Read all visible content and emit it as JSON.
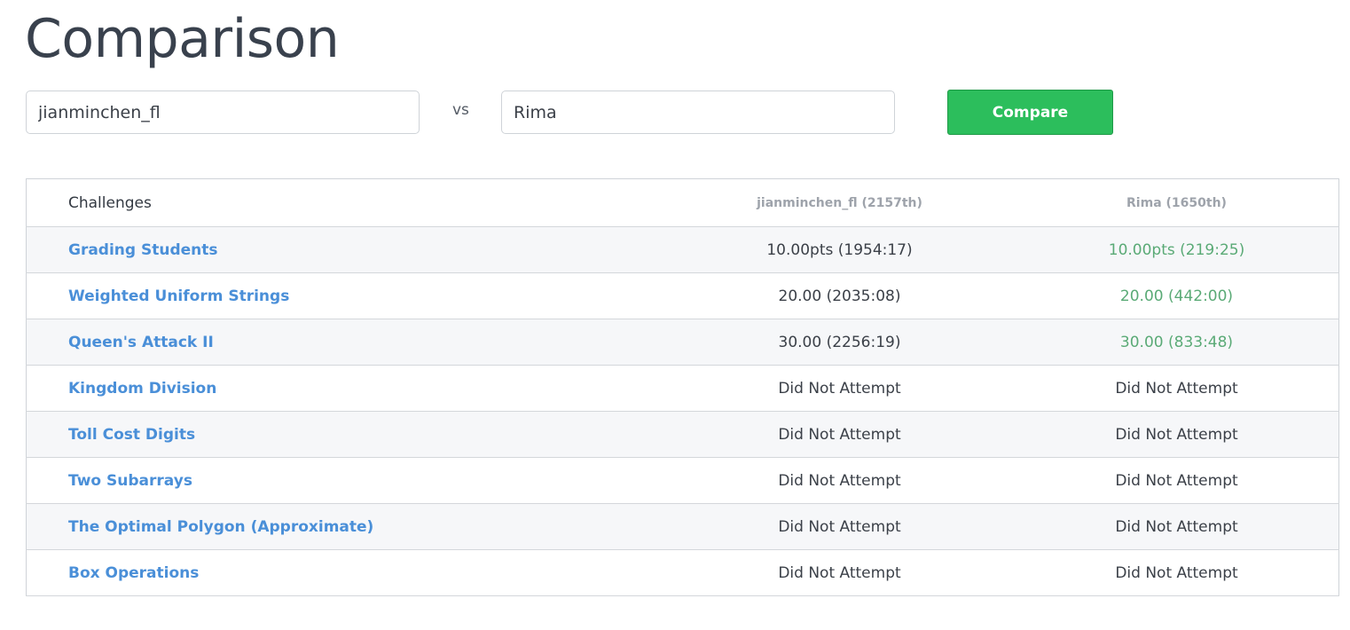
{
  "page": {
    "title": "Comparison"
  },
  "form": {
    "user_a_value": "jianminchen_fl",
    "vs_label": "vs",
    "user_b_value": "Rima",
    "compare_label": "Compare"
  },
  "table": {
    "header_challenges": "Challenges",
    "header_user_a": "jianminchen_fl (2157th)",
    "header_user_b": "Rima (1650th)",
    "rows": [
      {
        "challenge": "Grading Students",
        "user_a": "10.00pts (1954:17)",
        "user_b": "10.00pts (219:25)"
      },
      {
        "challenge": "Weighted Uniform Strings",
        "user_a": "20.00 (2035:08)",
        "user_b": "20.00 (442:00)"
      },
      {
        "challenge": "Queen's Attack II",
        "user_a": "30.00 (2256:19)",
        "user_b": "30.00 (833:48)"
      },
      {
        "challenge": "Kingdom Division",
        "user_a": "Did Not Attempt",
        "user_b": "Did Not Attempt"
      },
      {
        "challenge": "Toll Cost Digits",
        "user_a": "Did Not Attempt",
        "user_b": "Did Not Attempt"
      },
      {
        "challenge": "Two Subarrays",
        "user_a": "Did Not Attempt",
        "user_b": "Did Not Attempt"
      },
      {
        "challenge": "The Optimal Polygon (Approximate)",
        "user_a": "Did Not Attempt",
        "user_b": "Did Not Attempt"
      },
      {
        "challenge": "Box Operations",
        "user_a": "Did Not Attempt",
        "user_b": "Did Not Attempt"
      }
    ]
  },
  "colors": {
    "title": "#39414d",
    "link": "#4a8fd8",
    "button": "#2cbe5c",
    "winner_score": "#5aaa76",
    "row_alt": "#f6f7f9"
  }
}
